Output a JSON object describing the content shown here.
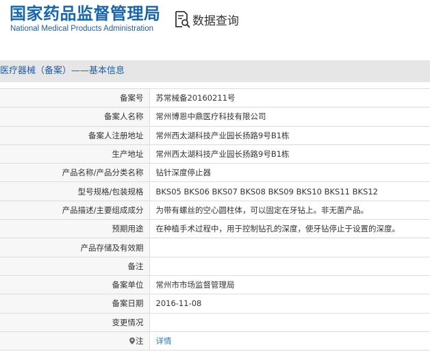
{
  "header": {
    "logo_cn": "国家药品监督管理局",
    "logo_en": "National Medical Products Administration",
    "query_label": "数据查询"
  },
  "section": {
    "title": "医疗器械（备案）——基本信息"
  },
  "rows": [
    {
      "key": "备案号",
      "value": "苏常械备20160211号"
    },
    {
      "key": "备案人名称",
      "value": "常州博恩中鼎医疗科技有限公司"
    },
    {
      "key": "备案人注册地址",
      "value": "常州西太湖科技产业园长扬路9号B1栋"
    },
    {
      "key": "生产地址",
      "value": "常州西太湖科技产业园长扬路9号B1栋"
    },
    {
      "key": "产品名称/产品分类名称",
      "value": "钻针深度停止器"
    },
    {
      "key": "型号规格/包装规格",
      "value": "BKS05 BKS06 BKS07 BKS08 BKS09 BKS10 BKS11 BKS12"
    },
    {
      "key": "产品描述/主要组成成分",
      "value": "为带有螺丝的空心圆柱体，可以固定在牙钻上。非无菌产品。"
    },
    {
      "key": "预期用途",
      "value": "在种植手术过程中，用于控制钻孔的深度，使牙钻停止于设置的深度。"
    },
    {
      "key": "产品存储及有效期",
      "value": ""
    },
    {
      "key": "备注",
      "value": ""
    },
    {
      "key": "备案单位",
      "value": "常州市市场监督管理局"
    },
    {
      "key": "备案日期",
      "value": "2016-11-08"
    },
    {
      "key": "变更情况",
      "value": ""
    },
    {
      "key": "注",
      "value": "详情"
    }
  ]
}
